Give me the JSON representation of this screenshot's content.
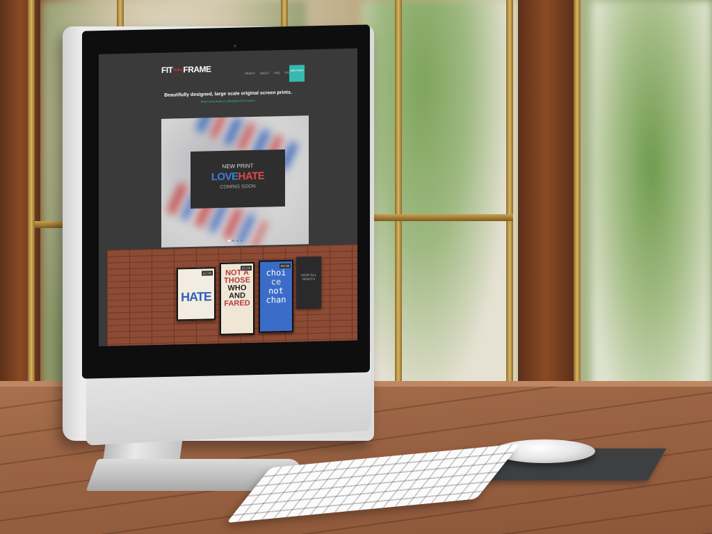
{
  "site": {
    "logo_left": "FIT",
    "logo_small": "FOR A",
    "logo_right": "FRAME",
    "nav": [
      "PRINTS",
      "ABOUT",
      "FAQ",
      "STOCKISTS"
    ],
    "cta_label": "NEW PRINT",
    "headline": "Beautifully designed, large scale original screen prints.",
    "subline": "Which fit perfectly in affordable IKEA frames."
  },
  "slider": {
    "new_label": "NEW PRINT",
    "title_part1": "LOVE",
    "title_part2": "HATE",
    "status": "COMING SOON",
    "active_dot": 1,
    "dot_count": 4
  },
  "prints": [
    {
      "price": "£17.00",
      "text": "HATE"
    },
    {
      "price": "£27.00",
      "text_lines": [
        "NOT A",
        "THOSE",
        "WHO",
        "AND",
        "FARED"
      ]
    },
    {
      "price": "£27.00",
      "text_lines": [
        "choi",
        "ce",
        "not",
        "chan"
      ]
    },
    {
      "text": "VIEW ALL PRINTS"
    }
  ],
  "colors": {
    "accent_teal": "#37b8b0",
    "love_blue": "#3b7fd6",
    "hate_red": "#e04848",
    "site_bg": "#3a3a3a"
  }
}
